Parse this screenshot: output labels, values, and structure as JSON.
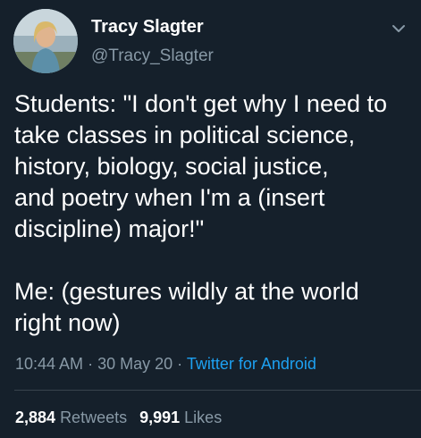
{
  "tweet": {
    "author": {
      "display_name": "Tracy Slagter",
      "handle": "@Tracy_Slagter"
    },
    "text": "Students: \"I don't get why I need to\ntake classes in political science,\nhistory, biology, social justice,\nand poetry when I'm a (insert\ndiscipline) major!\"\n\nMe: (gestures wildly at the world\nright now)",
    "time": "10:44 AM",
    "date": "30 May 20",
    "separator": "·",
    "source": "Twitter for Android",
    "retweets_count": "2,884",
    "retweets_label": "Retweets",
    "likes_count": "9,991",
    "likes_label": "Likes"
  },
  "colors": {
    "background": "#15202b",
    "secondary_text": "#8899a6",
    "link": "#1da1f2",
    "divider": "#38444d"
  },
  "icons": {
    "menu": "chevron-down-icon"
  }
}
